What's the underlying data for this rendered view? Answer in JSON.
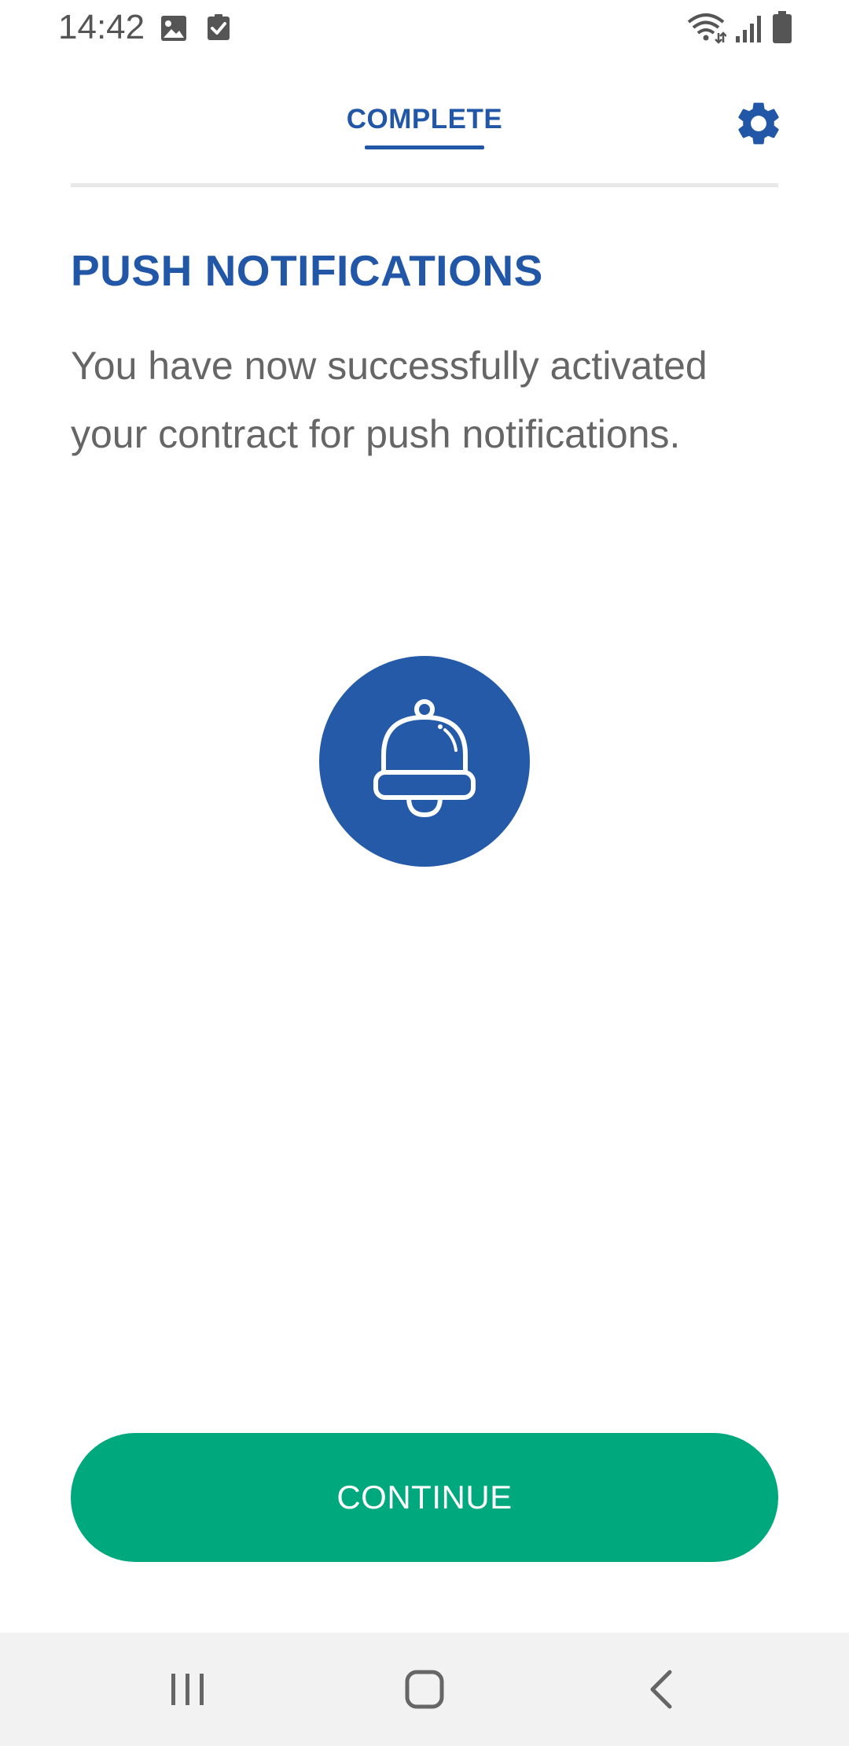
{
  "status_bar": {
    "time": "14:42",
    "icons": [
      "gallery-icon",
      "checkbox-icon",
      "wifi-icon",
      "signal-icon",
      "battery-icon"
    ]
  },
  "top_bar": {
    "tab_label": "COMPLETE",
    "settings_icon": "gear-icon"
  },
  "content": {
    "title": "PUSH NOTIFICATIONS",
    "description": "You have now successfully activated your contract for push notifications.",
    "illustration_icon": "bell-icon"
  },
  "actions": {
    "continue_label": "CONTINUE"
  },
  "nav_bar": {
    "icons": [
      "recents-icon",
      "home-icon",
      "back-icon"
    ]
  },
  "colors": {
    "brand_blue": "#2257a7",
    "accent_green": "#00a87e",
    "text_gray": "#666666"
  }
}
